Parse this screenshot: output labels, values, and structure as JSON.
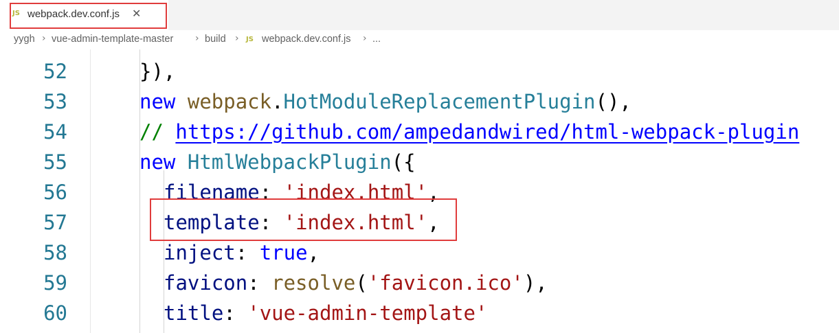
{
  "tab": {
    "icon": "JS",
    "title": "webpack.dev.conf.js",
    "close_glyph": "✕"
  },
  "breadcrumb": {
    "items": [
      {
        "label": "yygh"
      },
      {
        "label": "vue-admin-template-master"
      },
      {
        "label": "build"
      },
      {
        "icon": "JS",
        "label": "webpack.dev.conf.js"
      },
      {
        "label": "..."
      }
    ],
    "separator": "›"
  },
  "editor": {
    "lines": [
      {
        "number": "52",
        "indent": 0,
        "tokens": [
          {
            "t": "}),",
            "c": "punc"
          }
        ]
      },
      {
        "number": "53",
        "indent": 0,
        "tokens": [
          {
            "t": "new",
            "c": "kw"
          },
          {
            "t": " ",
            "c": "punc"
          },
          {
            "t": "webpack",
            "c": "fn"
          },
          {
            "t": ".",
            "c": "punc"
          },
          {
            "t": "HotModuleReplacementPlugin",
            "c": "cls"
          },
          {
            "t": "(),",
            "c": "punc"
          }
        ]
      },
      {
        "number": "54",
        "indent": 0,
        "tokens": [
          {
            "t": "// ",
            "c": "cmt"
          },
          {
            "t": "https://github.com/ampedandwired/html-webpack-plugin",
            "c": "lnk"
          }
        ]
      },
      {
        "number": "55",
        "indent": 0,
        "tokens": [
          {
            "t": "new",
            "c": "kw"
          },
          {
            "t": " ",
            "c": "punc"
          },
          {
            "t": "HtmlWebpackPlugin",
            "c": "cls"
          },
          {
            "t": "({",
            "c": "punc"
          }
        ]
      },
      {
        "number": "56",
        "indent": 1,
        "tokens": [
          {
            "t": "filename",
            "c": "prop"
          },
          {
            "t": ": ",
            "c": "punc"
          },
          {
            "t": "'index.html'",
            "c": "str"
          },
          {
            "t": ",",
            "c": "punc"
          }
        ]
      },
      {
        "number": "57",
        "indent": 1,
        "tokens": [
          {
            "t": "template",
            "c": "prop"
          },
          {
            "t": ": ",
            "c": "punc"
          },
          {
            "t": "'index.html'",
            "c": "str"
          },
          {
            "t": ",",
            "c": "punc"
          }
        ]
      },
      {
        "number": "58",
        "indent": 1,
        "tokens": [
          {
            "t": "inject",
            "c": "prop"
          },
          {
            "t": ": ",
            "c": "punc"
          },
          {
            "t": "true",
            "c": "kw"
          },
          {
            "t": ",",
            "c": "punc"
          }
        ]
      },
      {
        "number": "59",
        "indent": 1,
        "tokens": [
          {
            "t": "favicon",
            "c": "prop"
          },
          {
            "t": ": ",
            "c": "punc"
          },
          {
            "t": "resolve",
            "c": "fn"
          },
          {
            "t": "(",
            "c": "punc"
          },
          {
            "t": "'favicon.ico'",
            "c": "str"
          },
          {
            "t": "),",
            "c": "punc"
          }
        ]
      },
      {
        "number": "60",
        "indent": 1,
        "tokens": [
          {
            "t": "title",
            "c": "prop"
          },
          {
            "t": ": ",
            "c": "punc"
          },
          {
            "t": "'vue-admin-template'",
            "c": "str"
          }
        ]
      }
    ]
  },
  "colors": {
    "highlight_border": "#e03c3c",
    "line_number": "#237893",
    "keyword": "#0000ff",
    "string": "#a31515",
    "property": "#001080",
    "class": "#267f99",
    "function": "#795e26",
    "comment": "#008000"
  }
}
